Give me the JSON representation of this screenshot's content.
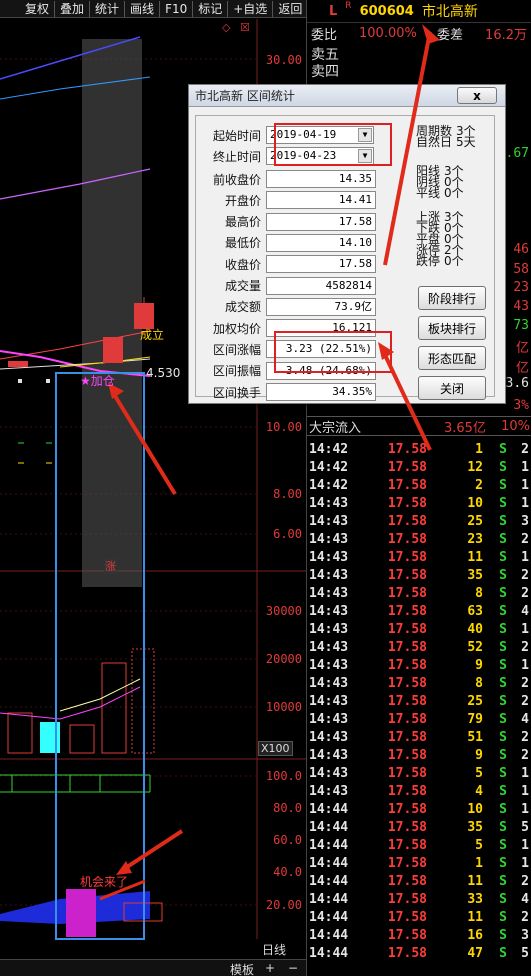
{
  "toolbar": {
    "items": [
      "复权",
      "叠加",
      "统计",
      "画线",
      "F10",
      "标记",
      "+自选",
      "返回"
    ]
  },
  "chart": {
    "price_ticks": [
      "30.00",
      "10.00",
      "8.00",
      "6.00"
    ],
    "volume_ticks": [
      "30000",
      "20000",
      "10000"
    ],
    "x100_label": "X100",
    "indicator_ticks": [
      "100.0",
      "80.0",
      "60.0",
      "40.0",
      "20.00"
    ],
    "last_price_label": "4.530",
    "cheng_li": "成立",
    "jia_cang": "★加仓",
    "zhang_badge": "涨",
    "chance_text": "机会来了",
    "period_label": "日线",
    "bottom_bar": {
      "template": "模板",
      "plus": "+",
      "minus": "−"
    },
    "colors": {
      "blue_box": "#3a8fe6",
      "arrow": "#e02a1a",
      "magenta": "#ff44ff"
    }
  },
  "quote": {
    "market_flag": "L",
    "r_flag": "R",
    "code": "600604",
    "name": "市北高新",
    "weibi_label": "委比",
    "weibi_value": "100.00%",
    "weicha_label": "委差",
    "weicha_value": "16.2万",
    "sell5": "卖五",
    "sell4": "卖四",
    "side_values": [
      {
        "text": ".67",
        "color": "#2fd62f"
      },
      {
        "text": "46",
        "color": "#e03a3a"
      },
      {
        "text": "58",
        "color": "#e03a3a"
      },
      {
        "text": "23",
        "color": "#e03a3a"
      },
      {
        "text": "43",
        "color": "#e03a3a"
      },
      {
        "text": "73",
        "color": "#2fd62f"
      },
      {
        "text": "亿",
        "color": "#e03a3a"
      },
      {
        "text": "亿",
        "color": "#e03a3a"
      },
      {
        "text": "3.6",
        "color": "#e6e6e6"
      },
      {
        "text": "3%",
        "color": "#e03a3a"
      }
    ],
    "block_trade_label": "大宗流入",
    "block_trade_amount": "3.65亿",
    "block_trade_pct": "10%"
  },
  "ticks": [
    {
      "time": "14:42",
      "price": "17.58",
      "vol": "1",
      "side": "S",
      "n": "2"
    },
    {
      "time": "14:42",
      "price": "17.58",
      "vol": "12",
      "side": "S",
      "n": "1"
    },
    {
      "time": "14:42",
      "price": "17.58",
      "vol": "2",
      "side": "S",
      "n": "1"
    },
    {
      "time": "14:43",
      "price": "17.58",
      "vol": "10",
      "side": "S",
      "n": "1"
    },
    {
      "time": "14:43",
      "price": "17.58",
      "vol": "25",
      "side": "S",
      "n": "3"
    },
    {
      "time": "14:43",
      "price": "17.58",
      "vol": "23",
      "side": "S",
      "n": "2"
    },
    {
      "time": "14:43",
      "price": "17.58",
      "vol": "11",
      "side": "S",
      "n": "1"
    },
    {
      "time": "14:43",
      "price": "17.58",
      "vol": "35",
      "side": "S",
      "n": "2"
    },
    {
      "time": "14:43",
      "price": "17.58",
      "vol": "8",
      "side": "S",
      "n": "2"
    },
    {
      "time": "14:43",
      "price": "17.58",
      "vol": "63",
      "side": "S",
      "n": "4"
    },
    {
      "time": "14:43",
      "price": "17.58",
      "vol": "40",
      "side": "S",
      "n": "1"
    },
    {
      "time": "14:43",
      "price": "17.58",
      "vol": "52",
      "side": "S",
      "n": "2"
    },
    {
      "time": "14:43",
      "price": "17.58",
      "vol": "9",
      "side": "S",
      "n": "1"
    },
    {
      "time": "14:43",
      "price": "17.58",
      "vol": "8",
      "side": "S",
      "n": "2"
    },
    {
      "time": "14:43",
      "price": "17.58",
      "vol": "25",
      "side": "S",
      "n": "2"
    },
    {
      "time": "14:43",
      "price": "17.58",
      "vol": "79",
      "side": "S",
      "n": "4"
    },
    {
      "time": "14:43",
      "price": "17.58",
      "vol": "51",
      "side": "S",
      "n": "2"
    },
    {
      "time": "14:43",
      "price": "17.58",
      "vol": "9",
      "side": "S",
      "n": "2"
    },
    {
      "time": "14:43",
      "price": "17.58",
      "vol": "5",
      "side": "S",
      "n": "1"
    },
    {
      "time": "14:43",
      "price": "17.58",
      "vol": "4",
      "side": "S",
      "n": "1"
    },
    {
      "time": "14:44",
      "price": "17.58",
      "vol": "10",
      "side": "S",
      "n": "1"
    },
    {
      "time": "14:44",
      "price": "17.58",
      "vol": "35",
      "side": "S",
      "n": "5"
    },
    {
      "time": "14:44",
      "price": "17.58",
      "vol": "5",
      "side": "S",
      "n": "1"
    },
    {
      "time": "14:44",
      "price": "17.58",
      "vol": "1",
      "side": "S",
      "n": "1"
    },
    {
      "time": "14:44",
      "price": "17.58",
      "vol": "11",
      "side": "S",
      "n": "2"
    },
    {
      "time": "14:44",
      "price": "17.58",
      "vol": "33",
      "side": "S",
      "n": "4"
    },
    {
      "time": "14:44",
      "price": "17.58",
      "vol": "11",
      "side": "S",
      "n": "2"
    },
    {
      "time": "14:44",
      "price": "17.58",
      "vol": "16",
      "side": "S",
      "n": "3"
    },
    {
      "time": "14:44",
      "price": "17.58",
      "vol": "47",
      "side": "S",
      "n": "5"
    }
  ],
  "dialog": {
    "title": "市北高新 区间统计",
    "close_label": "x",
    "start_label": "起始时间",
    "start_value": "2019-04-19",
    "end_label": "终止时间",
    "end_value": "2019-04-23",
    "fields": [
      {
        "label": "前收盘价",
        "value": "14.35"
      },
      {
        "label": "开盘价",
        "value": "14.41"
      },
      {
        "label": "最高价",
        "value": "17.58"
      },
      {
        "label": "最低价",
        "value": "14.10"
      },
      {
        "label": "收盘价",
        "value": "17.58"
      },
      {
        "label": "成交量",
        "value": "4582814"
      },
      {
        "label": "成交额",
        "value": "73.9亿"
      },
      {
        "label": "加权均价",
        "value": "16.121"
      },
      {
        "label": "区间涨幅",
        "value": "3.23 (22.51%)"
      },
      {
        "label": "区间振幅",
        "value": "3.48 (24.68%)"
      },
      {
        "label": "区间换手",
        "value": "34.35%"
      }
    ],
    "stats_top": [
      {
        "label": "周期数",
        "value": "3个"
      },
      {
        "label": "自然日",
        "value": "5天"
      }
    ],
    "stats_mid": [
      {
        "label": "阳线",
        "value": "3个"
      },
      {
        "label": "阴线",
        "value": "0个"
      },
      {
        "label": "平线",
        "value": "0个"
      }
    ],
    "stats_low": [
      {
        "label": "上涨",
        "value": "3个"
      },
      {
        "label": "下跌",
        "value": "0个"
      },
      {
        "label": "平盘",
        "value": "0个"
      },
      {
        "label": "涨停",
        "value": "2个"
      },
      {
        "label": "跌停",
        "value": "0个"
      }
    ],
    "buttons": [
      "阶段排行",
      "板块排行",
      "形态匹配",
      "关闭"
    ]
  }
}
